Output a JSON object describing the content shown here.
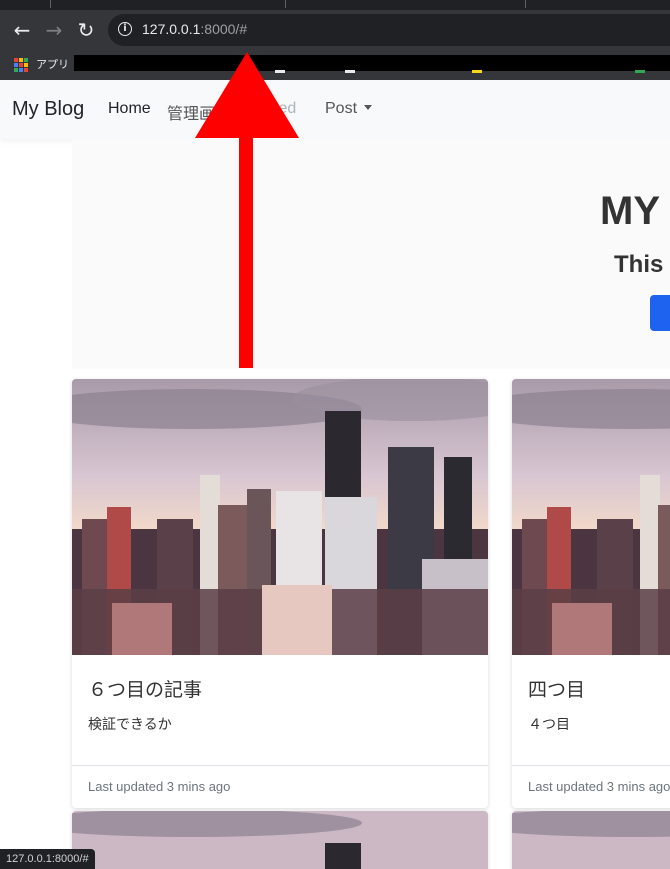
{
  "browser": {
    "url_host": "127.0.0.1",
    "url_rest": ":8000/#",
    "bookmarks_label": "アプリ",
    "status_url": "127.0.0.1:8000/#"
  },
  "nav": {
    "brand": "My Blog",
    "home": "Home",
    "admin": "管理画",
    "disabled": "bled",
    "post": "Post"
  },
  "jumbotron": {
    "title": "MY",
    "subtitle": "This i"
  },
  "cards": [
    {
      "title": "６つ目の記事",
      "text": "検証できるか",
      "footer": "Last updated 3 mins ago"
    },
    {
      "title": "四つ目",
      "text": "４つ目",
      "footer": "Last updated 3 mins ago"
    }
  ],
  "colors": {
    "accent_arrow": "#ff0000",
    "primary_button": "#1e63f0"
  }
}
